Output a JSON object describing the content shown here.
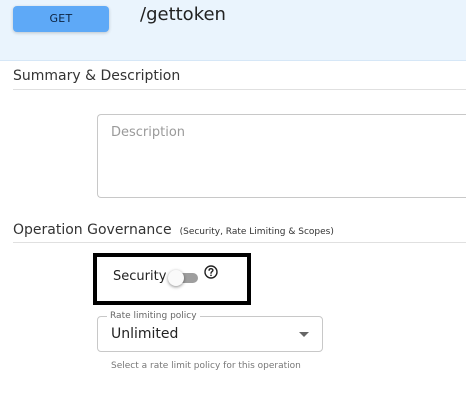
{
  "operation": {
    "method": "GET",
    "path": "/gettoken"
  },
  "summary_section": {
    "title": "Summary & Description",
    "description_placeholder": "Description",
    "description_value": ""
  },
  "governance_section": {
    "title": "Operation Governance",
    "subtitle": "(Security, Rate Limiting & Scopes)",
    "security": {
      "label": "Security",
      "enabled": false,
      "help_icon": "question-circle-icon"
    },
    "rate_limiting": {
      "label": "Rate limiting policy",
      "value": "Unlimited",
      "helper": "Select a rate limit policy for this operation",
      "dropdown_icon": "caret-down-icon"
    }
  },
  "colors": {
    "header_bg": "#eaf4fd",
    "method_badge": "#5ea9f7",
    "highlight_border": "#000000"
  }
}
